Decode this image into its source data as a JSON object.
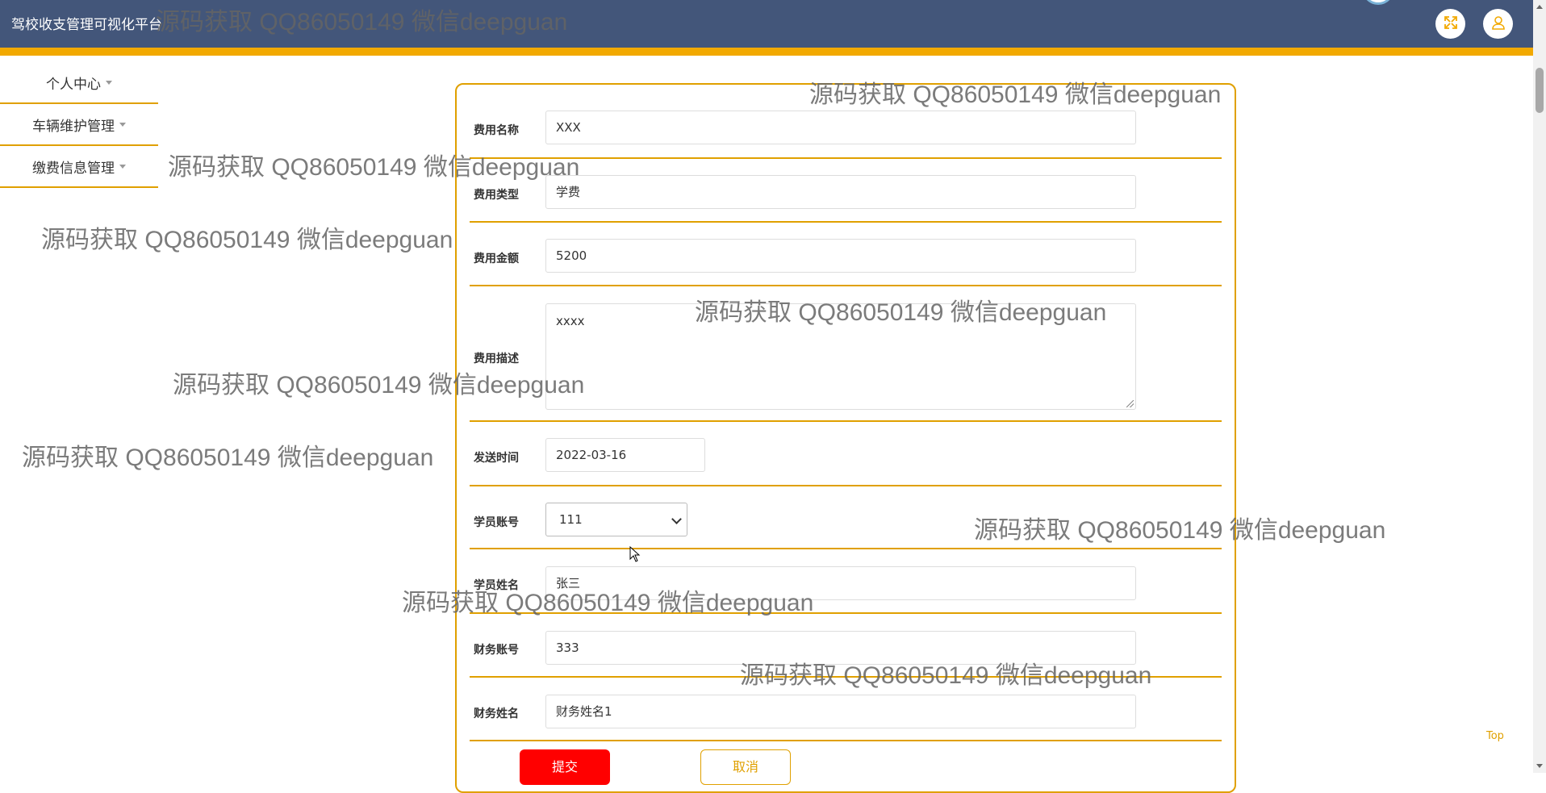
{
  "app": {
    "title": "驾校收支管理可视化平台"
  },
  "header": {
    "fullscreen_icon": "expand-arrows-icon",
    "user_icon": "user-icon"
  },
  "sidebar": {
    "items": [
      {
        "label": "个人中心"
      },
      {
        "label": "车辆维护管理"
      },
      {
        "label": "缴费信息管理"
      }
    ]
  },
  "form": {
    "fee_name": {
      "label": "费用名称",
      "value": "XXX"
    },
    "fee_type": {
      "label": "费用类型",
      "value": "学费"
    },
    "fee_amount": {
      "label": "费用金额",
      "value": "5200"
    },
    "fee_description": {
      "label": "费用描述",
      "value": "xxxx"
    },
    "send_time": {
      "label": "发送时间",
      "value": "2022-03-16"
    },
    "student_account": {
      "label": "学员账号",
      "value": "111"
    },
    "student_name": {
      "label": "学员姓名",
      "value": "张三"
    },
    "finance_account": {
      "label": "财务账号",
      "value": "333"
    },
    "finance_name": {
      "label": "财务姓名",
      "value": "财务姓名1"
    },
    "submit_label": "提交",
    "cancel_label": "取消"
  },
  "top_link": "Top",
  "watermark_text": "源码获取 QQ86050149 微信deepguan",
  "colors": {
    "header": "#43567a",
    "accent": "#f2a900",
    "submit": "#ff0000"
  }
}
